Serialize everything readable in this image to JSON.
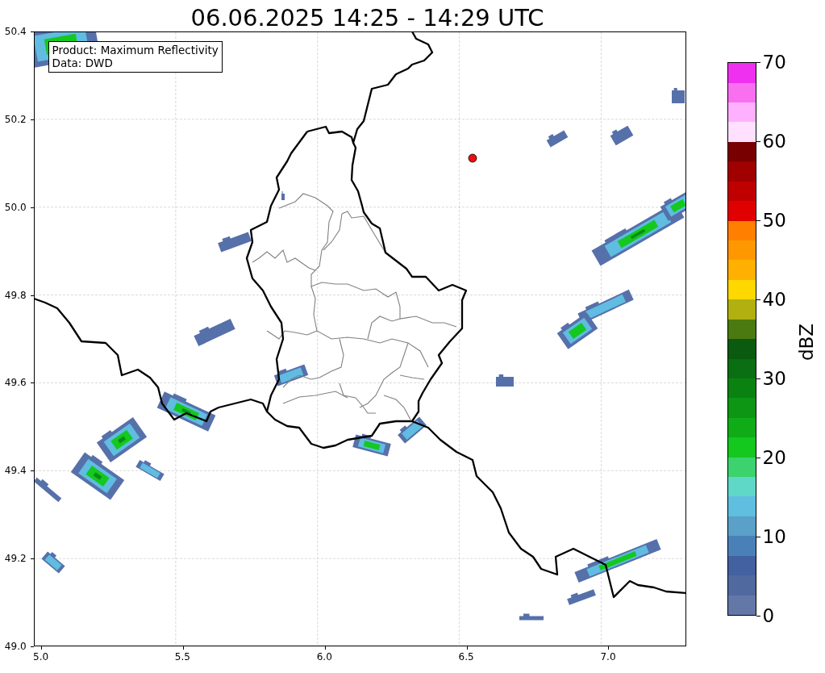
{
  "title": "06.06.2025 14:25 - 14:29 UTC",
  "legend": [
    "Product: Maximum Reflectivity",
    "Data: DWD"
  ],
  "map": {
    "x_ticks": [
      "5.0",
      "5.5",
      "6.0",
      "6.5",
      "7.0"
    ],
    "y_ticks": [
      "50.4",
      "50.2",
      "50.0",
      "49.8",
      "49.6",
      "49.4",
      "49.2",
      "49.0"
    ]
  },
  "colorbar": {
    "label": "dBZ",
    "ticks": [
      "70",
      "60",
      "50",
      "40",
      "30",
      "20",
      "10",
      "0"
    ],
    "bands": [
      {
        "color": "#6478a8"
      },
      {
        "color": "#506aa0"
      },
      {
        "color": "#4360a0"
      },
      {
        "color": "#4a80b8"
      },
      {
        "color": "#5aa0c8"
      },
      {
        "color": "#60bee0"
      },
      {
        "color": "#60d8c8"
      },
      {
        "color": "#3cd26e"
      },
      {
        "color": "#14c81e"
      },
      {
        "color": "#0fac18"
      },
      {
        "color": "#0c9614"
      },
      {
        "color": "#0a8212"
      },
      {
        "color": "#0a6e12"
      },
      {
        "color": "#0a5a10"
      },
      {
        "color": "#4a7a10"
      },
      {
        "color": "#b0b010"
      },
      {
        "color": "#ffd800"
      },
      {
        "color": "#ffb000"
      },
      {
        "color": "#ff9800"
      },
      {
        "color": "#ff8000"
      },
      {
        "color": "#e00000"
      },
      {
        "color": "#c00000"
      },
      {
        "color": "#a00000"
      },
      {
        "color": "#780000"
      },
      {
        "color": "#ffe0ff"
      },
      {
        "color": "#ffb0ff"
      },
      {
        "color": "#f870f0"
      },
      {
        "color": "#f030f0"
      }
    ]
  }
}
